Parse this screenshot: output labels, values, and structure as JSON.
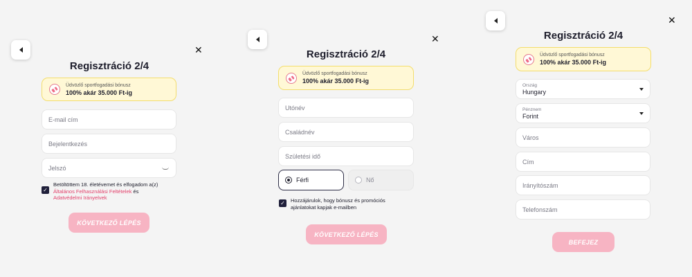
{
  "panel1": {
    "title": "Regisztráció 2/4",
    "bonus": {
      "subtitle": "Üdvözlő sportfogadási bónusz",
      "headline": "100% akár 35.000 Ft-ig"
    },
    "fields": {
      "email_placeholder": "E-mail cím",
      "login_placeholder": "Bejelentkezés",
      "password_placeholder": "Jelszó"
    },
    "terms": {
      "prefix": "Betöltöttem 18. életévemet és elfogadom a(z)",
      "link1": "Általános Felhasználási Feltételek",
      "middle": " és",
      "link2": "Adatvédelmi Irányelvek"
    },
    "cta": "KÖVETKEZŐ LÉPÉS"
  },
  "panel2": {
    "title": "Regisztráció 2/4",
    "bonus": {
      "subtitle": "Üdvözlő sportfogadási bónusz",
      "headline": "100% akár 35.000 Ft-ig"
    },
    "fields": {
      "firstname_placeholder": "Utónév",
      "lastname_placeholder": "Családnév",
      "birthdate_placeholder": "Születési idő"
    },
    "gender": {
      "male": "Férfi",
      "female": "Nő",
      "selected": "male"
    },
    "marketing": {
      "line1": "Hozzájárulok, hogy bónusz és promóciós",
      "line2": "ajánlatokat kapjak e-mailben"
    },
    "cta": "KÖVETKEZŐ LÉPÉS"
  },
  "panel3": {
    "title": "Regisztráció 2/4",
    "bonus": {
      "subtitle": "Üdvözlő sportfogadási bónusz",
      "headline": "100% akár 35.000 Ft-ig"
    },
    "country": {
      "label": "Ország",
      "value": "Hungary"
    },
    "currency": {
      "label": "Pénznem",
      "value": "Forint"
    },
    "fields": {
      "city_placeholder": "Város",
      "address_placeholder": "Cím",
      "zip_placeholder": "Irányítószám",
      "phone_placeholder": "Telefonszám"
    },
    "cta": "BEFEJEZ"
  },
  "icons": {
    "back": "chevron-left-icon",
    "close": "close-icon",
    "gift": "gift-icon",
    "eye": "eye-closed-icon",
    "check": "check-icon",
    "radio": "radio-icon",
    "caret": "caret-down-icon"
  },
  "colors": {
    "cta_bg": "#f7b4c3",
    "link": "#e2416b",
    "bonus_bg": "#fff8d6",
    "bonus_border": "#f3dd6b",
    "checkbox": "#1f1f3a"
  }
}
